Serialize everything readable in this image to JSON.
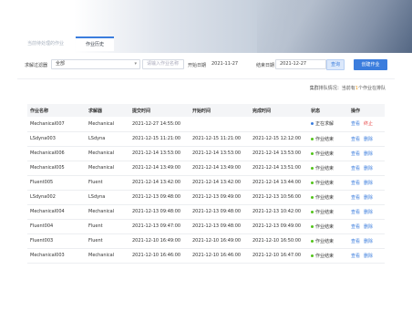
{
  "tabs": [
    {
      "label": "当前待处理的作业",
      "active": false
    },
    {
      "label": "作业历史",
      "active": true
    }
  ],
  "filters": {
    "solver_label": "求解过滤器",
    "solver_value": "全部",
    "name_placeholder": "请输入作业名称",
    "start_label": "开始日期",
    "start_value": "2021-11-27",
    "end_label": "结束日期",
    "end_value": "2021-12-27",
    "query_button": "查询",
    "create_button": "创建作业"
  },
  "queue": {
    "prefix": "集群排队情况：当前有",
    "count": "1",
    "suffix": "个作业在排队"
  },
  "columns": [
    "作业名称",
    "求解器",
    "提交时间",
    "开始时间",
    "完成时间",
    "状态",
    "操作"
  ],
  "rows": [
    {
      "name": "Mechanical007",
      "solver": "Mechanical",
      "submit": "2021-12-27 14:55:00",
      "start": "",
      "end": "",
      "status": "正在求解",
      "status_type": "running",
      "act1": "查看",
      "act2": "终止"
    },
    {
      "name": "LSdyna003",
      "solver": "LSdyna",
      "submit": "2021-12-15 11:21:00",
      "start": "2021-12-15 11:21:00",
      "end": "2021-12-15 12:12:00",
      "status": "作业结束",
      "status_type": "done",
      "act1": "查看",
      "act2": "删除"
    },
    {
      "name": "Mechanical006",
      "solver": "Mechanical",
      "submit": "2021-12-14 13:53:00",
      "start": "2021-12-14 13:53:00",
      "end": "2021-12-14 13:53:00",
      "status": "作业结束",
      "status_type": "done",
      "act1": "查看",
      "act2": "删除"
    },
    {
      "name": "Mechanical005",
      "solver": "Mechanical",
      "submit": "2021-12-14 13:49:00",
      "start": "2021-12-14 13:49:00",
      "end": "2021-12-14 13:51:00",
      "status": "作业结束",
      "status_type": "done",
      "act1": "查看",
      "act2": "删除"
    },
    {
      "name": "Fluent005",
      "solver": "Fluent",
      "submit": "2021-12-14 13:42:00",
      "start": "2021-12-14 13:42:00",
      "end": "2021-12-14 13:44:00",
      "status": "作业结束",
      "status_type": "done",
      "act1": "查看",
      "act2": "删除"
    },
    {
      "name": "LSdyna002",
      "solver": "LSdyna",
      "submit": "2021-12-13 09:48:00",
      "start": "2021-12-13 09:49:00",
      "end": "2021-12-13 10:56:00",
      "status": "作业结束",
      "status_type": "done",
      "act1": "查看",
      "act2": "删除"
    },
    {
      "name": "Mechanical004",
      "solver": "Mechanical",
      "submit": "2021-12-13 09:48:00",
      "start": "2021-12-13 09:48:00",
      "end": "2021-12-13 10:42:00",
      "status": "作业结束",
      "status_type": "done",
      "act1": "查看",
      "act2": "删除"
    },
    {
      "name": "Fluent004",
      "solver": "Fluent",
      "submit": "2021-12-13 09:47:00",
      "start": "2021-12-13 09:48:00",
      "end": "2021-12-13 09:49:00",
      "status": "作业结束",
      "status_type": "done",
      "act1": "查看",
      "act2": "删除"
    },
    {
      "name": "Fluent003",
      "solver": "Fluent",
      "submit": "2021-12-10 16:49:00",
      "start": "2021-12-10 16:49:00",
      "end": "2021-12-10 16:50:00",
      "status": "作业结束",
      "status_type": "done",
      "act1": "查看",
      "act2": "删除"
    },
    {
      "name": "Mechanical003",
      "solver": "Mechanical",
      "submit": "2021-12-10 16:46:00",
      "start": "2021-12-10 16:46:00",
      "end": "2021-12-10 16:47:00",
      "status": "作业结束",
      "status_type": "done",
      "act1": "查看",
      "act2": "删除"
    }
  ]
}
